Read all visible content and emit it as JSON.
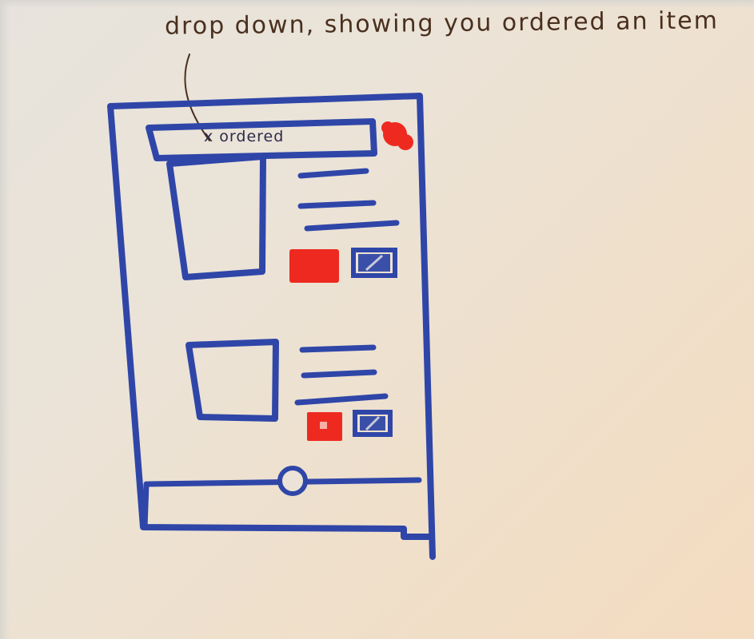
{
  "annotation": {
    "text": "drop down, showing you ordered an item"
  },
  "dropdown": {
    "text": "x ordered"
  },
  "colors": {
    "pen_blue": "#2f46a8",
    "pen_red": "#ee2a20",
    "pencil": "#4a2f1e",
    "paper": "#ebe3d7"
  },
  "icons": [
    "close-icon",
    "notification-badge",
    "order-button",
    "save-checkbox",
    "slider-handle"
  ]
}
